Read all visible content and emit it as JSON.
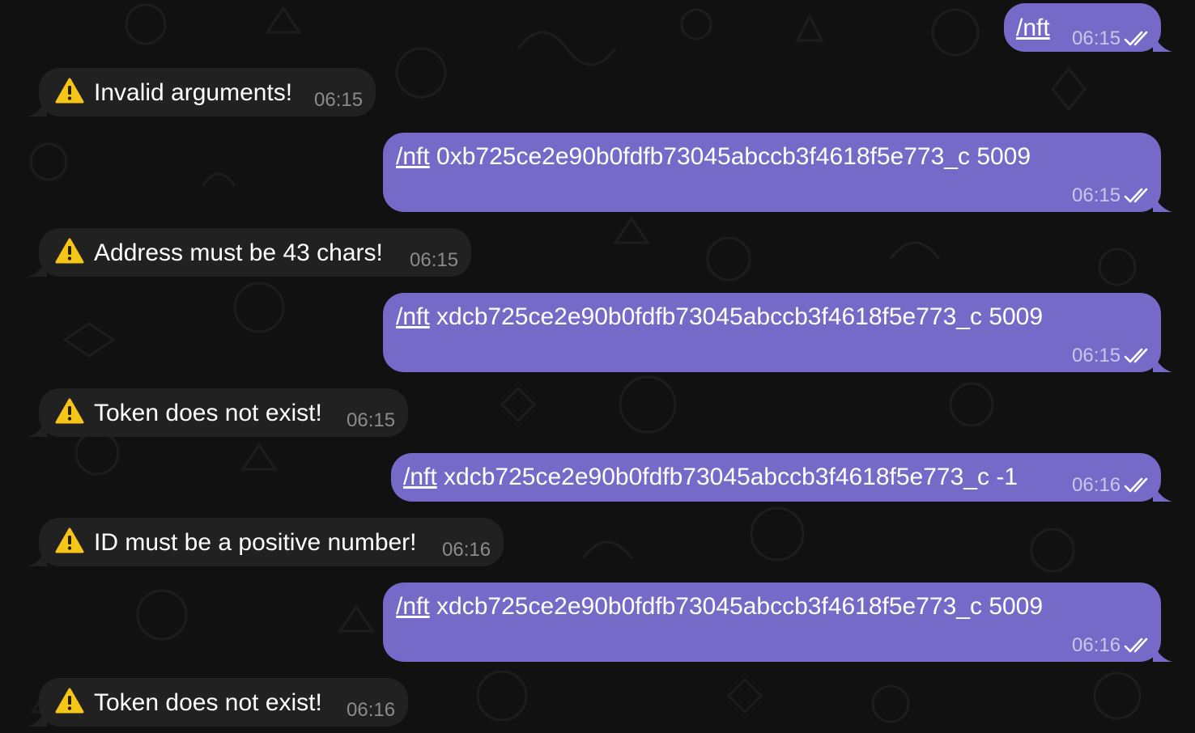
{
  "messages": [
    {
      "direction": "outgoing",
      "command": "/nft",
      "text": "",
      "time": "06:15",
      "status": "read"
    },
    {
      "direction": "incoming",
      "icon": "warning-icon",
      "text": "Invalid arguments!",
      "time": "06:15"
    },
    {
      "direction": "outgoing",
      "command": "/nft",
      "text": "0xb725ce2e90b0fdfb73045abccb3f4618f5e773_c 5009",
      "time": "06:15",
      "status": "read"
    },
    {
      "direction": "incoming",
      "icon": "warning-icon",
      "text": "Address must be 43 chars!",
      "time": "06:15"
    },
    {
      "direction": "outgoing",
      "command": "/nft",
      "text": "xdcb725ce2e90b0fdfb73045abccb3f4618f5e773_c 5009",
      "time": "06:15",
      "status": "read"
    },
    {
      "direction": "incoming",
      "icon": "warning-icon",
      "text": "Token does not exist!",
      "time": "06:15"
    },
    {
      "direction": "outgoing",
      "command": "/nft",
      "text": "xdcb725ce2e90b0fdfb73045abccb3f4618f5e773_c -1",
      "time": "06:16",
      "status": "read"
    },
    {
      "direction": "incoming",
      "icon": "warning-icon",
      "text": "ID must be a positive number!",
      "time": "06:16"
    },
    {
      "direction": "outgoing",
      "command": "/nft",
      "text": "xdcb725ce2e90b0fdfb73045abccb3f4618f5e773_c 5009",
      "time": "06:16",
      "status": "read"
    },
    {
      "direction": "incoming",
      "icon": "warning-icon",
      "text": "Token does not exist!",
      "time": "06:16"
    }
  ],
  "colors": {
    "background": "#111111",
    "outgoing_bubble": "#766ac8",
    "incoming_bubble": "#212121",
    "warning_icon": "#f5c518"
  }
}
